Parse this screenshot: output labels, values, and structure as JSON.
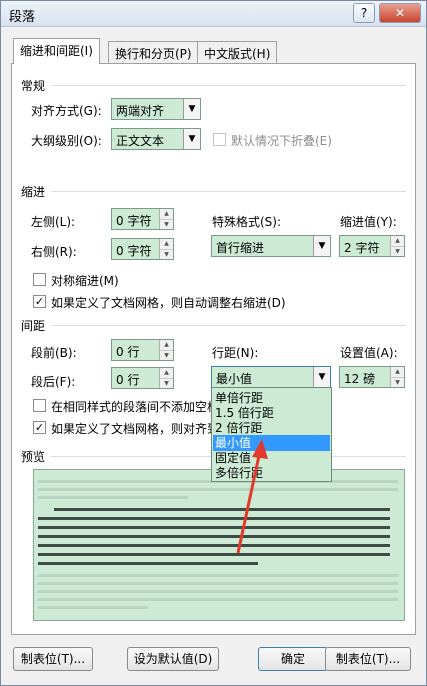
{
  "window": {
    "title": "段落",
    "help_label": "?",
    "close_label": "✕"
  },
  "tabs": [
    {
      "label": "缩进和间距(I)"
    },
    {
      "label": "换行和分页(P)"
    },
    {
      "label": "中文版式(H)"
    }
  ],
  "general": {
    "heading": "常规",
    "alignment_label": "对齐方式(G):",
    "alignment_value": "两端对齐",
    "outline_label": "大纲级别(O):",
    "outline_value": "正文文本",
    "collapse_label": "默认情况下折叠(E)"
  },
  "indent": {
    "heading": "缩进",
    "left_label": "左侧(L):",
    "left_value": "0 字符",
    "right_label": "右侧(R):",
    "right_value": "0 字符",
    "special_label": "特殊格式(S):",
    "special_value": "首行缩进",
    "by_label": "缩进值(Y):",
    "by_value": "2 字符",
    "mirror_label": "对称缩进(M)",
    "auto_adjust_label": "如果定义了文档网格，则自动调整右缩进(D)"
  },
  "spacing": {
    "heading": "间距",
    "before_label": "段前(B):",
    "before_value": "0 行",
    "after_label": "段后(F):",
    "after_value": "0 行",
    "line_label": "行距(N):",
    "line_value": "最小值",
    "at_label": "设置值(A):",
    "at_value": "12 磅",
    "no_space_label": "在相同样式的段落间不添加空格",
    "snap_grid_label": "如果定义了文档网格，则对齐到"
  },
  "line_spacing_options": [
    "单倍行距",
    "1.5 倍行距",
    "2 倍行距",
    "最小值",
    "固定值",
    "多倍行距"
  ],
  "line_spacing_selected": "最小值",
  "preview": {
    "heading": "预览"
  },
  "buttons": {
    "tabs_label": "制表位(T)...",
    "default_label": "设为默认值(D)",
    "ok_label": "确定",
    "cancel_label": "制表位(T)..."
  },
  "colors": {
    "field_fill": "#ccead4",
    "selection": "#3399ff",
    "arrow": "#e03a2c"
  }
}
